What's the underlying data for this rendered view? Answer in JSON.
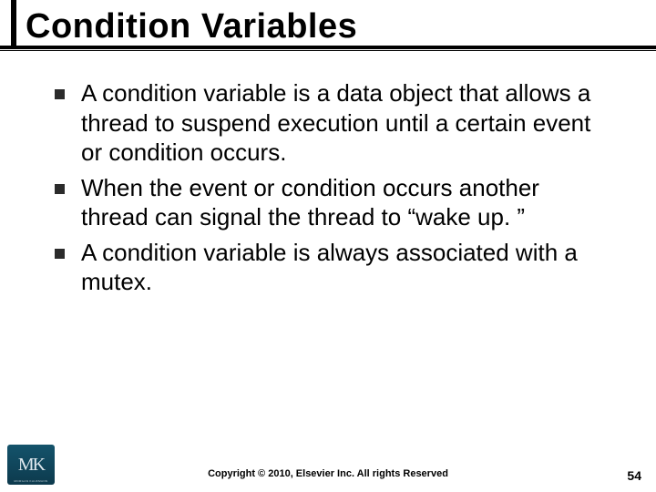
{
  "title": "Condition Variables",
  "bullets": [
    "A condition variable is a data object that allows a thread to suspend execution until a certain event or condition occurs.",
    "When the event or condition occurs another thread can signal the thread to “wake up. ”",
    "A condition variable is always associated with a mutex."
  ],
  "logo": {
    "initials": "MK",
    "subtext": "MORGAN KAUFMANN"
  },
  "copyright": "Copyright © 2010, Elsevier Inc. All rights Reserved",
  "page_number": "54"
}
